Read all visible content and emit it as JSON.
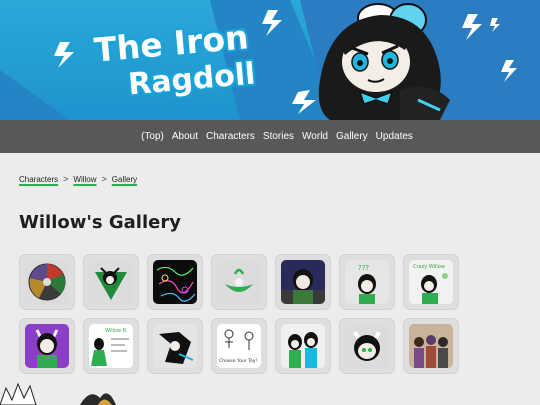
{
  "header": {
    "title_line1": "The Iron",
    "title_line2": "Ragdoll"
  },
  "nav": {
    "items": [
      "(Top)",
      "About",
      "Characters",
      "Stories",
      "World",
      "Gallery",
      "Updates"
    ]
  },
  "breadcrumb": {
    "items": [
      "Characters",
      "Willow",
      "Gallery"
    ],
    "separator": ">"
  },
  "page": {
    "title": "Willow's Gallery"
  },
  "gallery": {
    "thumbnail_count": 15,
    "thumbnail_labels": [
      "???",
      "Crazy Willow",
      "Willow R.",
      "Choose Your Toy!"
    ]
  },
  "colors": {
    "banner_blue": "#1f93cc",
    "nav_gray": "#585858",
    "page_bg": "#ececec",
    "accent_green": "#2fae4f"
  }
}
